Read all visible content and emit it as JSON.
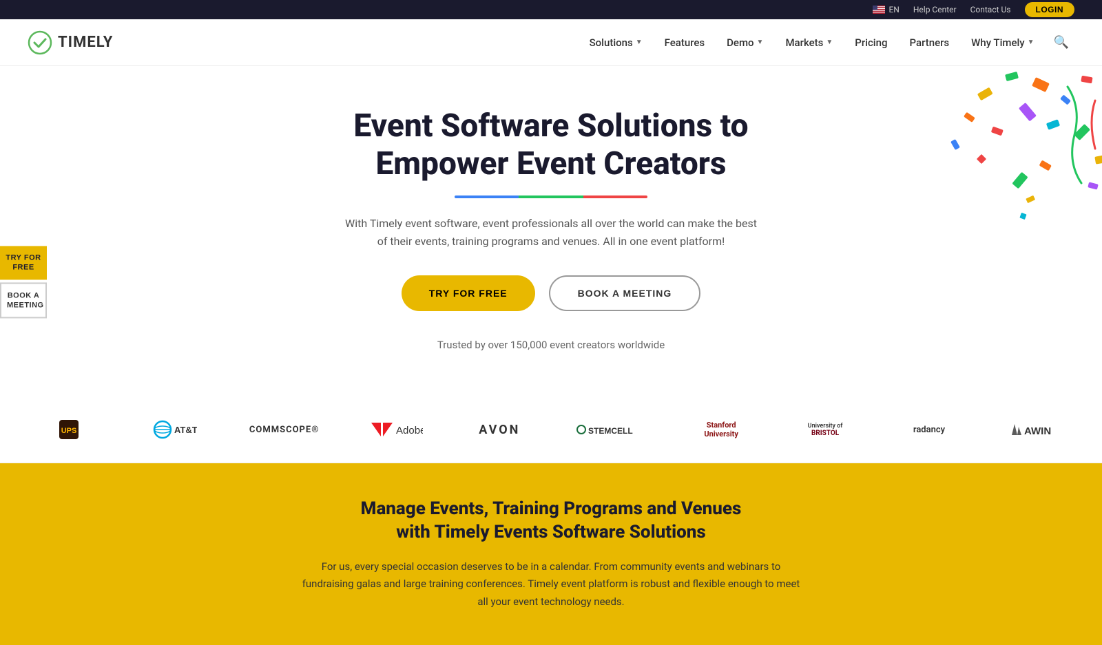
{
  "topbar": {
    "lang": "EN",
    "help_center": "Help Center",
    "contact_us": "Contact Us",
    "login": "LOGIN"
  },
  "nav": {
    "logo_text": "TIMELY",
    "items": [
      {
        "label": "Solutions",
        "has_dropdown": true
      },
      {
        "label": "Features",
        "has_dropdown": false
      },
      {
        "label": "Demo",
        "has_dropdown": true
      },
      {
        "label": "Markets",
        "has_dropdown": true
      },
      {
        "label": "Pricing",
        "has_dropdown": false
      },
      {
        "label": "Partners",
        "has_dropdown": false
      },
      {
        "label": "Why Timely",
        "has_dropdown": true
      }
    ]
  },
  "hero": {
    "title_line1": "Event Software Solutions to",
    "title_line2": "Empower Event Creators",
    "subtitle": "With Timely event software, event professionals all over the world can make the best of their events, training programs and venues. All in one event platform!",
    "btn_try": "TRY FOR FREE",
    "btn_meeting": "BOOK A MEETING",
    "trusted": "Trusted by over 150,000 event creators worldwide"
  },
  "logos": [
    {
      "name": "UPS",
      "icon": "ups"
    },
    {
      "name": "AT&T",
      "icon": "att"
    },
    {
      "name": "COMMSCOPE",
      "icon": "commscope"
    },
    {
      "name": "Adobe",
      "icon": "adobe"
    },
    {
      "name": "AVON",
      "icon": "avon"
    },
    {
      "name": "STEMCELL",
      "icon": "stemcell"
    },
    {
      "name": "Stanford University",
      "icon": "stanford"
    },
    {
      "name": "University of Bristol",
      "icon": "bristol"
    },
    {
      "name": "radancy",
      "icon": "radancy"
    },
    {
      "name": "AWIN",
      "icon": "awin"
    }
  ],
  "yellow_section": {
    "title_line1": "Manage Events, Training Programs and Venues",
    "title_line2": "with Timely Events Software Solutions",
    "text": "For us, every special occasion deserves to be in a calendar. From community events and webinars to fundraising galas and large training conferences. Timely event platform is robust and flexible enough to meet all your event technology needs."
  },
  "side_buttons": [
    {
      "label": "TRY FOR\nFREE",
      "style": "yellow"
    },
    {
      "label": "BOOK A\nMEETING",
      "style": "outline"
    }
  ],
  "colors": {
    "yellow": "#e8b800",
    "dark": "#1a1a2e",
    "green_logo": "#5cb85c"
  }
}
